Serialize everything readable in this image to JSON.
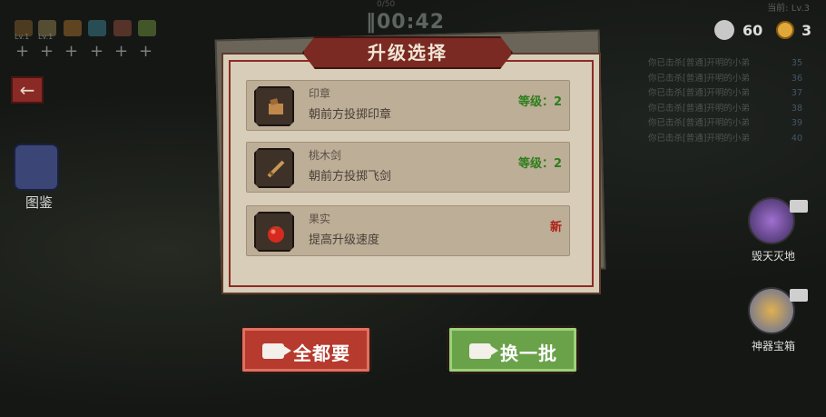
{
  "hud": {
    "timer": "00:42",
    "timer_sub": "0/50",
    "level_top": "当前: Lv.3",
    "kills": "60",
    "coins": "3",
    "weapon_levels": [
      "Lv.1",
      "Lv.1"
    ]
  },
  "kill_log": [
    {
      "text": "你已击杀[普通]开明的小弟",
      "n": "35"
    },
    {
      "text": "你已击杀[普通]开明的小弟",
      "n": "36"
    },
    {
      "text": "你已击杀[普通]开明的小弟",
      "n": "37"
    },
    {
      "text": "你已击杀[普通]开明的小弟",
      "n": "38"
    },
    {
      "text": "你已击杀[普通]开明的小弟",
      "n": "39"
    },
    {
      "text": "你已击杀[普通]开明的小弟",
      "n": "40"
    }
  ],
  "left": {
    "back_glyph": "←",
    "book_label": "图鉴"
  },
  "right": {
    "item1_label": "毁天灭地",
    "item2_label": "神器宝箱"
  },
  "dialog": {
    "title": "升级选择",
    "options": [
      {
        "name": "印章",
        "desc": "朝前方投掷印章",
        "badge": "等级：2",
        "icon": "seal-icon"
      },
      {
        "name": "桃木剑",
        "desc": "朝前方投掷飞剑",
        "badge": "等级：2",
        "icon": "wooden-sword-icon"
      },
      {
        "name": "果实",
        "desc": "提高升级速度",
        "badge": "新",
        "icon": "tomato-fruit-icon"
      }
    ]
  },
  "buttons": {
    "take_all": "全都要",
    "reroll": "换一批"
  },
  "colors": {
    "accent_red": "#b63a2e",
    "accent_green": "#6aa24a",
    "level_green": "#2e7d1b",
    "new_red": "#b01e14"
  }
}
